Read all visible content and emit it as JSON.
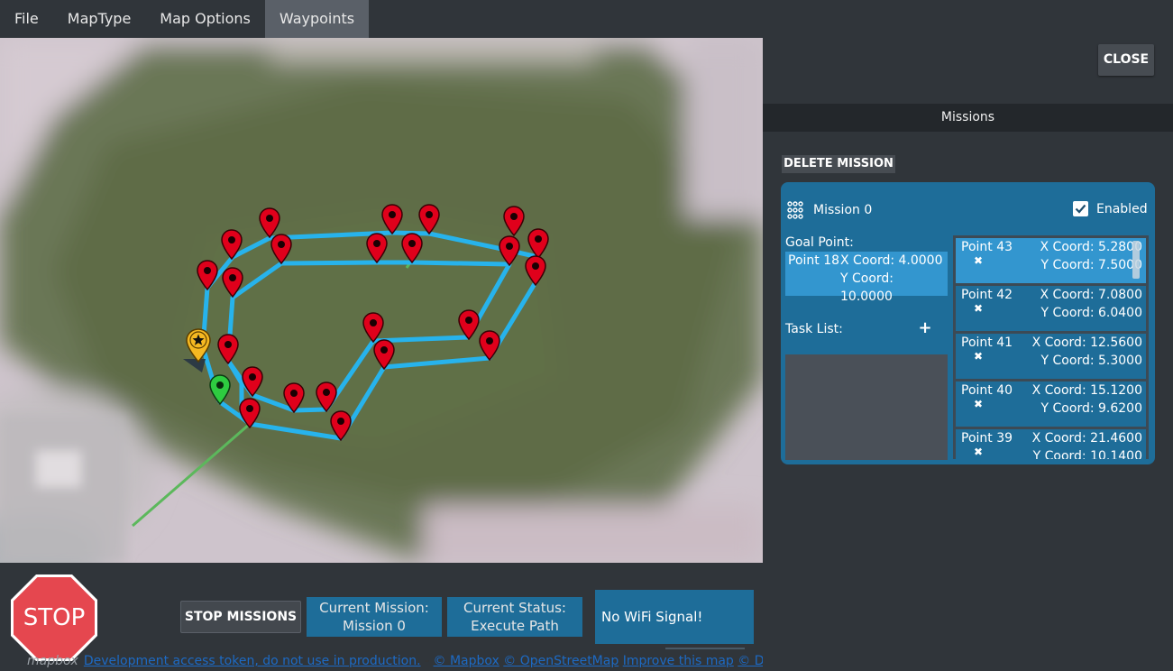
{
  "menu": {
    "items": [
      {
        "label": "File",
        "active": false
      },
      {
        "label": "MapType",
        "active": false
      },
      {
        "label": "Map Options",
        "active": false
      },
      {
        "label": "Waypoints",
        "active": true
      }
    ]
  },
  "panel": {
    "close_label": "CLOSE",
    "missions_header": "Missions",
    "delete_mission_label": "DELETE MISSION",
    "mission": {
      "name": "Mission 0",
      "enabled_label": "Enabled",
      "enabled": true,
      "goal_label": "Goal Point:",
      "goal": {
        "point": "Point 18",
        "x": "X Coord: 4.0000",
        "y": "Y Coord: 10.0000"
      },
      "task_label": "Task List:",
      "add_task_icon": "+",
      "points": [
        {
          "name": "Point 43",
          "x": "X Coord: 5.2800",
          "y": "Y Coord: 7.5000",
          "selected": true
        },
        {
          "name": "Point 42",
          "x": "X Coord: 7.0800",
          "y": "Y Coord: 6.0400",
          "selected": false
        },
        {
          "name": "Point 41",
          "x": "X Coord: 12.5600",
          "y": "Y Coord: 5.3000",
          "selected": false
        },
        {
          "name": "Point 40",
          "x": "X Coord: 15.1200",
          "y": "Y Coord: 9.6200",
          "selected": false
        },
        {
          "name": "Point 39",
          "x": "X Coord: 21.4600",
          "y": "Y Coord: 10.1400",
          "selected": false
        }
      ],
      "delete_point_icon": "✖"
    }
  },
  "bottom": {
    "stop_sign_label": "STOP",
    "stop_missions_label": "STOP MISSIONS",
    "current_mission_title": "Current Mission:",
    "current_mission_value": "Mission 0",
    "current_status_title": "Current Status:",
    "current_status_value": "Execute Path",
    "wifi_status": "No WiFi Signal!",
    "attribution": {
      "mapbox": "mapbox",
      "token_warning": "Development access token, do not use in production.",
      "sep": " - ",
      "mapbox_link": "© Mapbox",
      "osm_link": "© OpenStreetMap",
      "improve_link": "Improve this map",
      "digitalglobe_link": "© DigitalGlobe"
    }
  },
  "colors": {
    "path": "#27b3ec",
    "marker": "#e0001b",
    "start_marker": "#2ecc40",
    "home_marker": "#f5b821",
    "trail": "#5cb85c",
    "accent": "#1e6d99",
    "accent_light": "#3396cf"
  },
  "icons": {
    "stop": "stop-sign-icon",
    "grid": "drag-grid-icon",
    "check": "checkmark-icon",
    "delete": "close-icon",
    "add": "plus-icon",
    "waypoint": "map-pin-icon",
    "home": "star-pin-icon"
  }
}
